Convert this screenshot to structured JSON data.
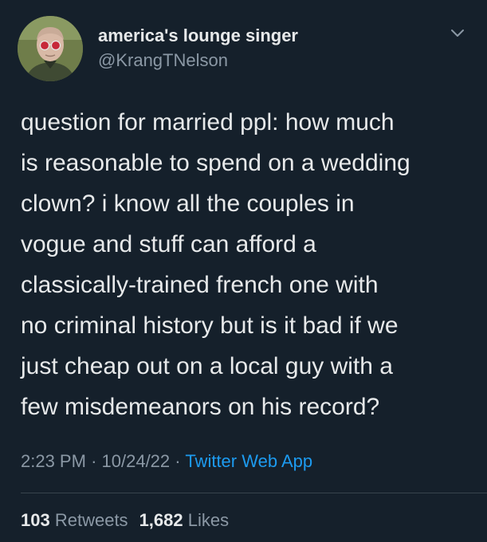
{
  "user": {
    "display_name": "america's lounge singer",
    "handle": "@KrangTNelson"
  },
  "tweet": {
    "text": "question for married ppl: how much\nis reasonable to spend on a wedding\nclown? i know all the couples in\nvogue and stuff can afford a\nclassically-trained french one with\nno criminal history but is it bad if we\njust cheap out on a local guy with a\nfew misdemeanors on his record?",
    "time": "2:23 PM",
    "separator": "·",
    "date": "10/24/22",
    "source": "Twitter Web App"
  },
  "stats": {
    "retweets_count": "103",
    "retweets_label": "Retweets",
    "likes_count": "1,682",
    "likes_label": "Likes"
  },
  "icons": {
    "menu": "chevron-down-icon"
  },
  "colors": {
    "background": "#15202b",
    "text": "#e7e9ea",
    "muted": "#8b98a5",
    "link": "#1d9bf0"
  }
}
